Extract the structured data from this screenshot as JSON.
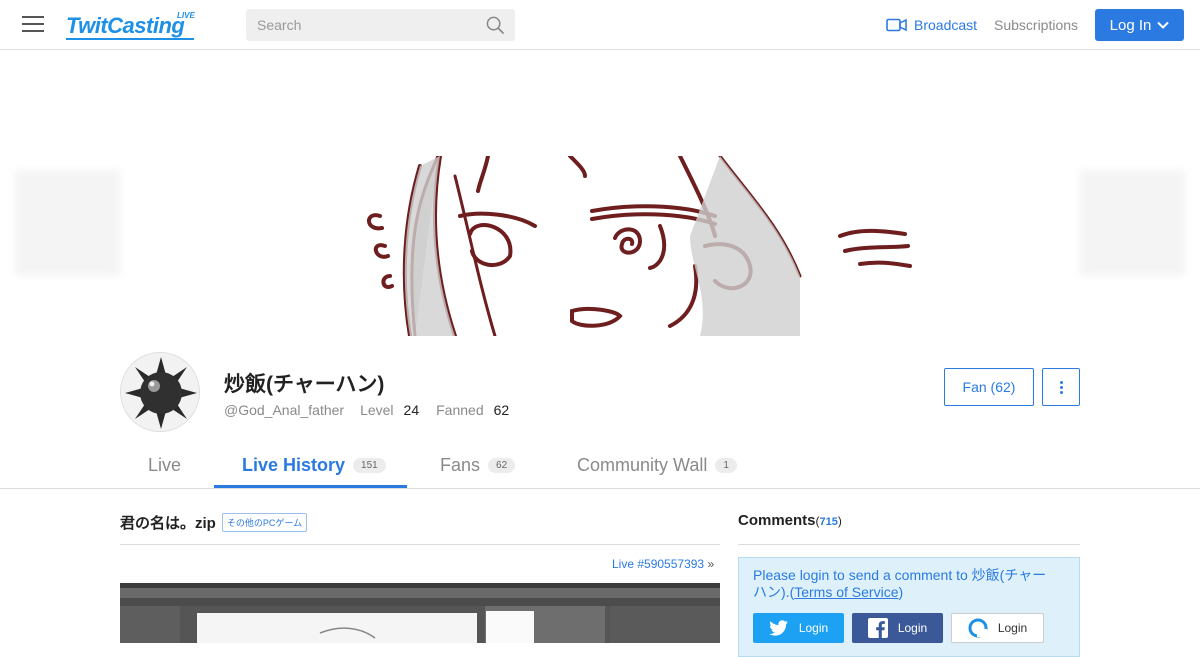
{
  "header": {
    "logo_text": "TwitCasting",
    "logo_badge": "LIVE",
    "search_placeholder": "Search",
    "broadcast_label": "Broadcast",
    "subscriptions_label": "Subscriptions",
    "login_label": "Log In"
  },
  "profile": {
    "name": "炒飯(チャーハン)",
    "handle": "@God_Anal_father",
    "level_label": "Level",
    "level_value": "24",
    "fanned_label": "Fanned",
    "fanned_value": "62",
    "fan_button": "Fan (62)"
  },
  "tabs": [
    {
      "label": "Live",
      "count": ""
    },
    {
      "label": "Live History",
      "count": "151"
    },
    {
      "label": "Fans",
      "count": "62"
    },
    {
      "label": "Community Wall",
      "count": "1"
    }
  ],
  "movie": {
    "title": "君の名は。zip",
    "category": "その他のPCゲーム",
    "live_link": "Live #590557393",
    "live_link_arrow": "»"
  },
  "comments": {
    "heading": "Comments",
    "count_open": "(",
    "count": "715",
    "count_close": ")",
    "login_message": "Please login to send a comment to 炒飯(チャーハン).",
    "tos_open": "(",
    "tos_label": "Terms of Service",
    "tos_close": ")",
    "twitter_login": "Login",
    "facebook_login": "Login",
    "twitcasting_login": "Login"
  },
  "colors": {
    "accent": "#2a7ae2",
    "brand": "#1e90e6",
    "twitter": "#1da1f2",
    "facebook": "#3b5998"
  },
  "icons": [
    "hamburger-menu-icon",
    "search-icon",
    "video-camera-icon",
    "chevron-down-icon",
    "more-vertical-icon",
    "twitter-icon",
    "facebook-icon",
    "twitcasting-icon"
  ]
}
